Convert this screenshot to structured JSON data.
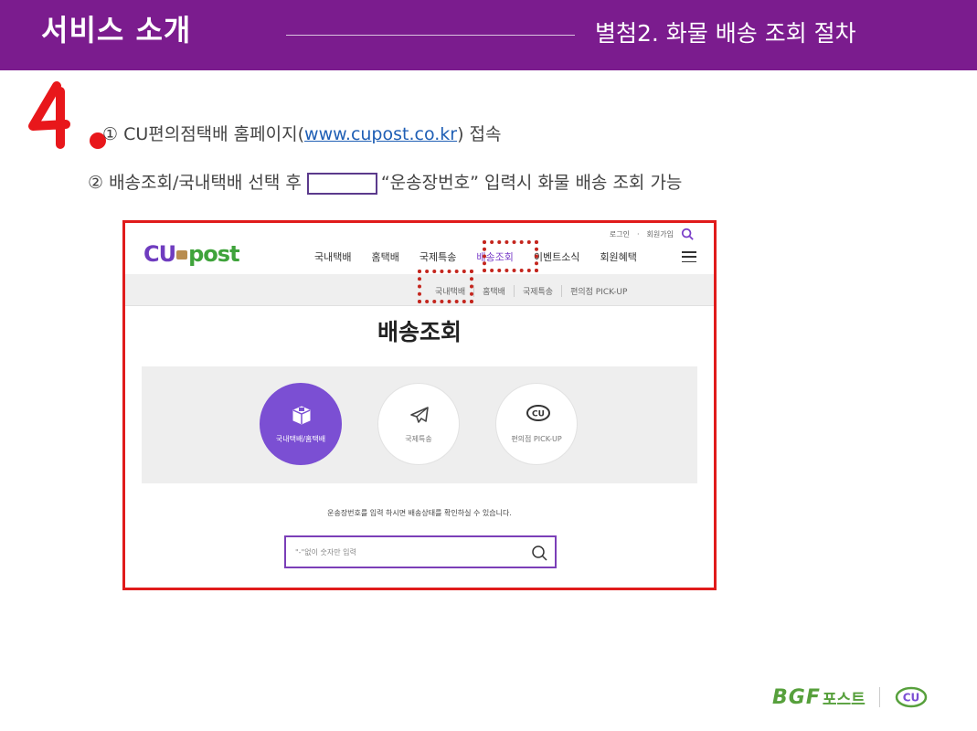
{
  "slide": {
    "title": "서비스 소개",
    "subtitle": "별첨2. 화물 배송 조회 절차",
    "step_number": "4."
  },
  "instructions": {
    "line1_prefix": "① CU편의점택배 홈페이지(",
    "line1_link": "www.cupost.co.kr",
    "line1_suffix": ") 접속",
    "line2_prefix": "② 배송조회/국내택배 선택 후",
    "line2_suffix": "“운송장번호” 입력시 화물 배송 조회 가능"
  },
  "website": {
    "logo_cu": "CU",
    "logo_post": "post",
    "util_links": [
      "로그인",
      "·",
      "회원가입"
    ],
    "nav": [
      "국내택배",
      "홈택배",
      "국제특송",
      "배송조회",
      "이벤트소식",
      "회원혜택"
    ],
    "nav_active": "배송조회",
    "subnav": [
      "국내택배",
      "홈택배",
      "국제특송",
      "편의점 PICK-UP"
    ],
    "page_heading": "배송조회",
    "categories": [
      {
        "label": "국내택배/홈택배",
        "icon": "box-icon",
        "selected": true
      },
      {
        "label": "국제특송",
        "icon": "airplane-icon",
        "selected": false
      },
      {
        "label": "편의점 PICK-UP",
        "icon": "cu-logo-icon",
        "selected": false
      }
    ],
    "notice": "운송장번호를 입력 하시면 배송상태를 확인하실 수 있습니다.",
    "search_placeholder": "\"-\"없이 숫자만 입력"
  },
  "footer": {
    "brand": "BGF",
    "brand_sub": "포스트",
    "brand_cu": "CU"
  },
  "colors": {
    "header_bg": "#7b1c8e",
    "accent_purple": "#7b4fd3",
    "highlight_red": "#e01b1b",
    "link_blue": "#1f5fb5",
    "brand_green": "#57a03c"
  }
}
